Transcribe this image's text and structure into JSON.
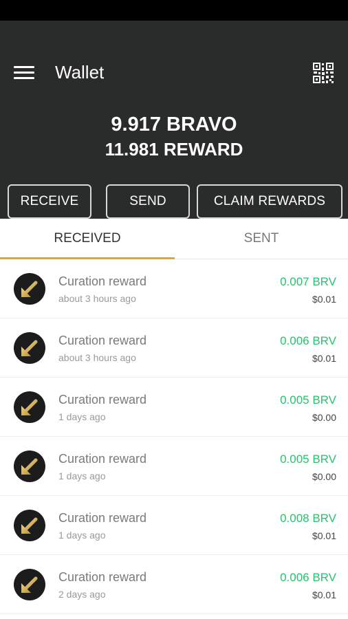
{
  "header": {
    "title": "Wallet",
    "menu_icon": "hamburger-menu-icon",
    "qr_icon": "qr-code-icon",
    "balance_bravo": "9.917 BRAVO",
    "balance_reward": "11.981 REWARD"
  },
  "actions": {
    "receive": "RECEIVE",
    "send": "SEND",
    "claim": "CLAIM REWARDS"
  },
  "tabs": [
    {
      "label": "RECEIVED",
      "active": true
    },
    {
      "label": "SENT",
      "active": false
    }
  ],
  "transactions": [
    {
      "title": "Curation reward",
      "time": "about 3 hours ago",
      "amount": "0.007 BRV",
      "usd": "$0.01",
      "icon": "received-arrow-icon"
    },
    {
      "title": "Curation reward",
      "time": "about 3 hours ago",
      "amount": "0.006 BRV",
      "usd": "$0.01",
      "icon": "received-arrow-icon"
    },
    {
      "title": "Curation reward",
      "time": "1 days ago",
      "amount": "0.005 BRV",
      "usd": "$0.00",
      "icon": "received-arrow-icon"
    },
    {
      "title": "Curation reward",
      "time": "1 days ago",
      "amount": "0.005 BRV",
      "usd": "$0.00",
      "icon": "received-arrow-icon"
    },
    {
      "title": "Curation reward",
      "time": "1 days ago",
      "amount": "0.008 BRV",
      "usd": "$0.01",
      "icon": "received-arrow-icon"
    },
    {
      "title": "Curation reward",
      "time": "2 days ago",
      "amount": "0.006 BRV",
      "usd": "$0.01",
      "icon": "received-arrow-icon"
    }
  ],
  "colors": {
    "header_bg": "#2a2b2b",
    "accent_gold": "#c8ab5a",
    "amount_green": "#2bbf6e"
  }
}
